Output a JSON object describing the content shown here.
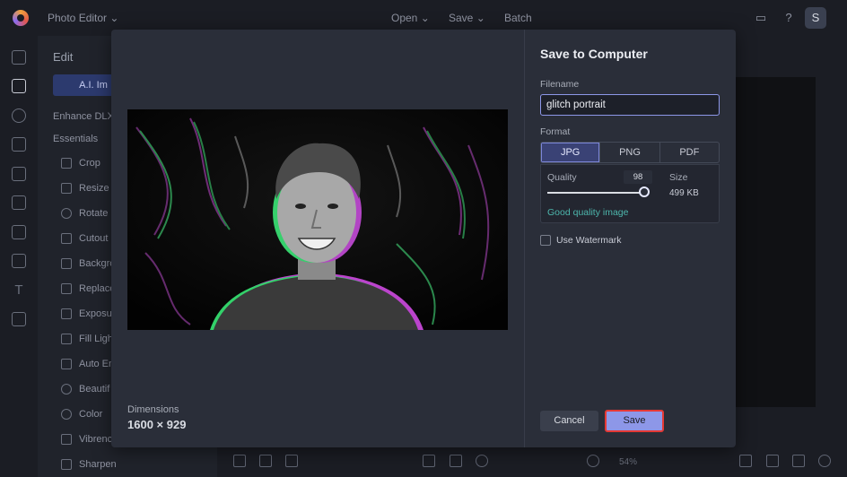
{
  "topbar": {
    "app_name": "Photo Editor",
    "menu": [
      "Open",
      "Save",
      "Batch"
    ],
    "avatar_initial": "S"
  },
  "left_panel": {
    "title": "Edit",
    "ai_button": "A.I. Im",
    "enhance": "Enhance DLX",
    "section": "Essentials",
    "tools": [
      "Crop",
      "Resize",
      "Rotate",
      "Cutout",
      "Backgro",
      "Replace",
      "Exposu",
      "Fill Ligh",
      "Auto En",
      "Beautif",
      "Color",
      "Vibrenc",
      "Sharpen"
    ]
  },
  "bottom": {
    "zoom": "54%"
  },
  "modal": {
    "title": "Save to Computer",
    "filename_label": "Filename",
    "filename_value": "glitch portrait",
    "format_label": "Format",
    "formats": [
      "JPG",
      "PNG",
      "PDF"
    ],
    "selected_format": "JPG",
    "quality_label": "Quality",
    "quality_value": "98",
    "quality_fraction": 0.98,
    "size_label": "Size",
    "size_value": "499 KB",
    "quality_note": "Good quality image",
    "watermark_label": "Use Watermark",
    "watermark_checked": false,
    "dimensions_label": "Dimensions",
    "dimensions_value": "1600 × 929",
    "cancel_label": "Cancel",
    "save_label": "Save"
  },
  "colors": {
    "accent": "#8d97e8",
    "good": "#4db6ac",
    "highlight": "#e53935"
  }
}
